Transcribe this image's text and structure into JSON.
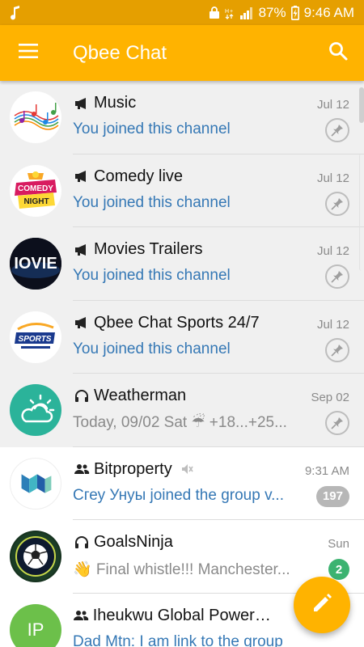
{
  "status_bar": {
    "battery": "87%",
    "time": "9:46 AM",
    "bg_color": "#e59f00"
  },
  "app_bar": {
    "title": "Qbee Chat",
    "bg_color": "#ffb300"
  },
  "chats": [
    {
      "type": "channel",
      "type_icon": "megaphone-icon",
      "title": "Music",
      "date": "Jul 12",
      "message": "You joined this channel",
      "message_style": "blue",
      "action": "pin",
      "avatar": "music-notes-logo"
    },
    {
      "type": "channel",
      "type_icon": "megaphone-icon",
      "title": "Comedy live",
      "date": "Jul 12",
      "message": "You joined this channel",
      "message_style": "blue",
      "action": "pin",
      "avatar": "comedy-night-logo",
      "avatar_text": [
        "COMEDY",
        "NIGHT"
      ]
    },
    {
      "type": "channel",
      "type_icon": "megaphone-icon",
      "title": "Movies Trailers",
      "date": "Jul 12",
      "message": "You joined this channel",
      "message_style": "blue",
      "action": "pin",
      "avatar": "movie-logo",
      "avatar_text": "IOVIE"
    },
    {
      "type": "channel",
      "type_icon": "megaphone-icon",
      "title": "Qbee Chat Sports 24/7",
      "date": "Jul 12",
      "message": "You joined this channel",
      "message_style": "blue",
      "action": "pin",
      "avatar": "sports-performance-logo",
      "avatar_text": "SPORTS"
    },
    {
      "type": "bot",
      "type_icon": "headset-icon",
      "title": "Weatherman",
      "date": "Sep 02",
      "message": "Today, 09/02 Sat ☔ +18...+25...",
      "message_style": "gray",
      "action": "pin",
      "avatar": "weather-cloud-sun-logo"
    },
    {
      "type": "group",
      "type_icon": "group-icon",
      "title": "Bitproperty",
      "muted": true,
      "date": "9:31 AM",
      "message": "Сгеу Унуы joined the group v...",
      "message_style": "blue",
      "action": "badge",
      "badge": "197",
      "badge_color": "gray",
      "avatar": "bitproperty-logo"
    },
    {
      "type": "bot",
      "type_icon": "headset-icon",
      "title": "GoalsNinja",
      "date": "Sun",
      "message": "👋 Final whistle!!!  Manchester...",
      "message_style": "gray",
      "action": "badge",
      "badge": "2",
      "badge_color": "green",
      "avatar": "soccer-ball-logo"
    },
    {
      "type": "group",
      "type_icon": "group-icon",
      "title": "Iheukwu Global Power (J...",
      "date": "",
      "message": "Dad Mtn: I am link to the group",
      "message_style": "blue",
      "action": "none",
      "avatar": "initials",
      "initials": "IP",
      "avatar_color": "#6cc04a"
    }
  ],
  "colors": {
    "accent": "#ffb300",
    "link_blue": "#3578b5",
    "muted_gray": "#8a8a8a",
    "pinned_bg": "#f0f0f0"
  }
}
